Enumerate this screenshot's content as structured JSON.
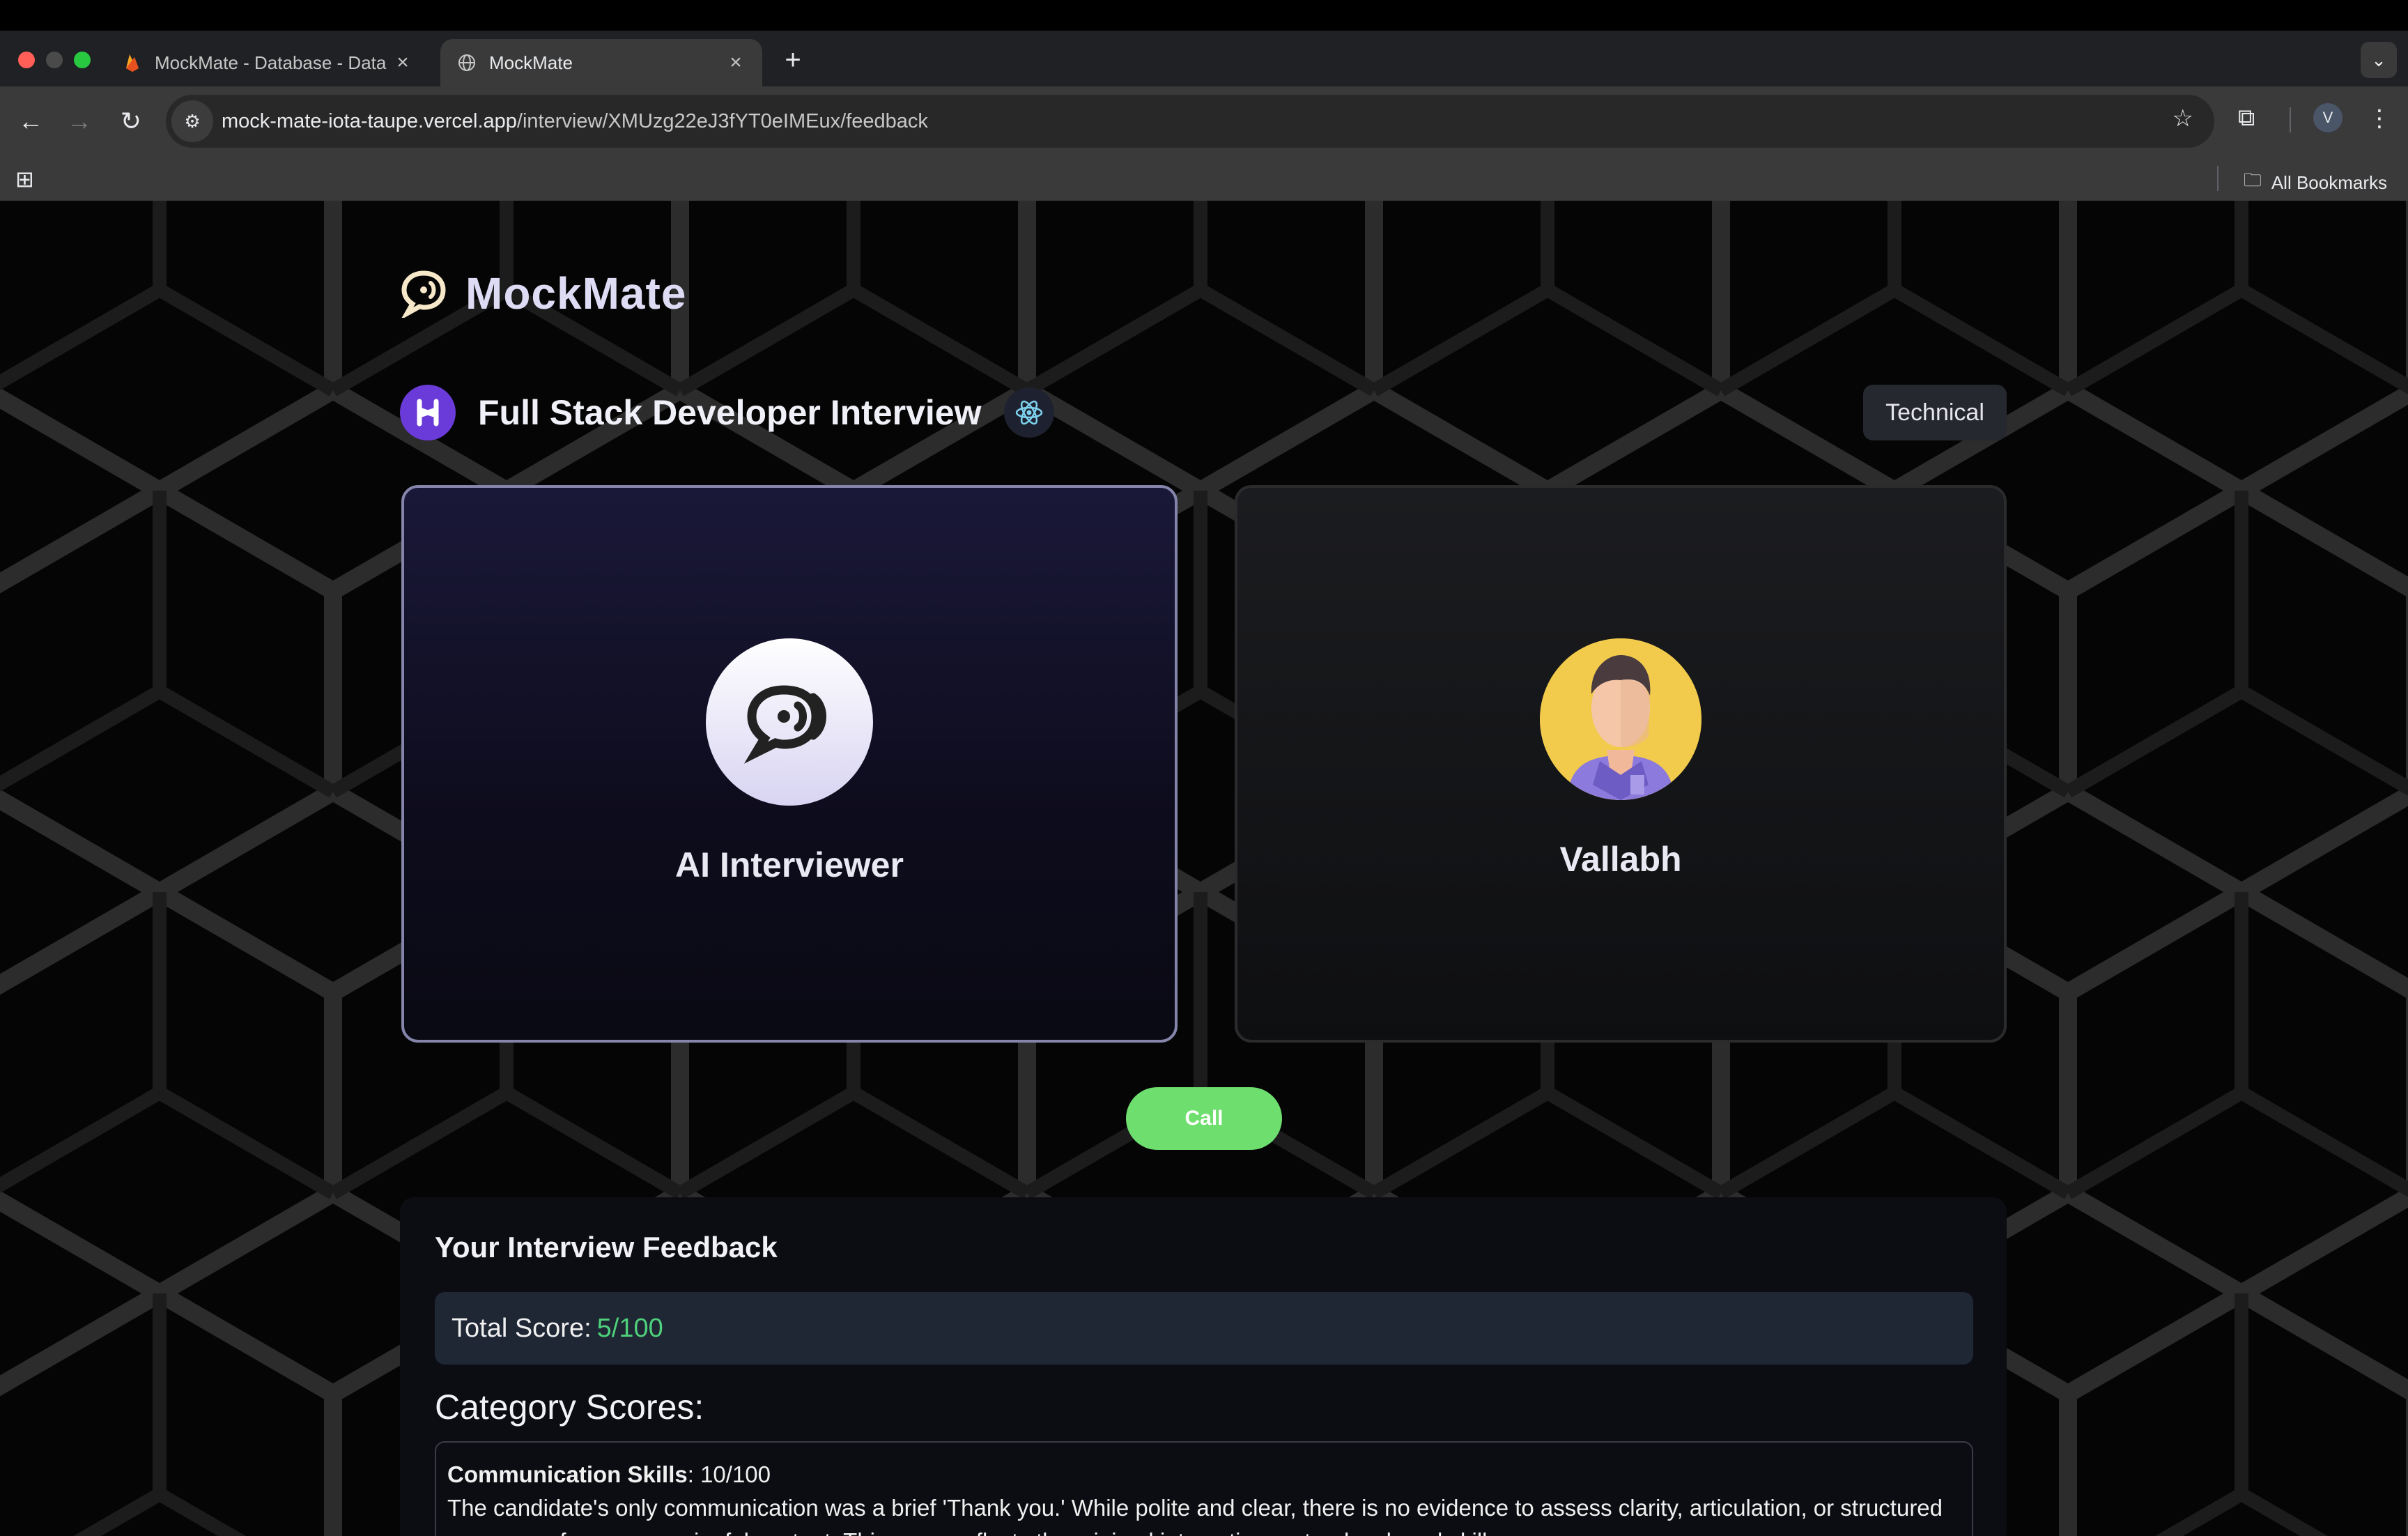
{
  "browser": {
    "tabs": [
      {
        "title": "MockMate - Database - Data",
        "active": false
      },
      {
        "title": "MockMate",
        "active": true
      }
    ],
    "url_host": "mock-mate-iota-taupe.vercel.app",
    "url_path": "/interview/XMUzg22eJ3fYT0eIMEux/feedback",
    "profile_initial": "V",
    "all_bookmarks": "All Bookmarks"
  },
  "app": {
    "logo_text": "MockMate",
    "interview_title": "Full Stack Developer Interview",
    "type_tag": "Technical",
    "ai_card_name": "AI Interviewer",
    "user_card_name": "Vallabh",
    "call_label": "Call"
  },
  "feedback": {
    "title": "Your Interview Feedback",
    "total_label": "Total Score:",
    "total_value": "5/100",
    "category_heading": "Category Scores:",
    "categories": [
      {
        "name": "Communication Skills",
        "score": ": 10/100",
        "comment": "The candidate's only communication was a brief 'Thank you.' While polite and clear, there is no evidence to assess clarity, articulation, or structured responses for any meaningful content. This score reflects the minimal interaction, not a developed skill."
      }
    ]
  },
  "colors": {
    "accent_purple": "#6b3bd9",
    "call_green": "#6ede6e",
    "score_green": "#4ed17a"
  }
}
